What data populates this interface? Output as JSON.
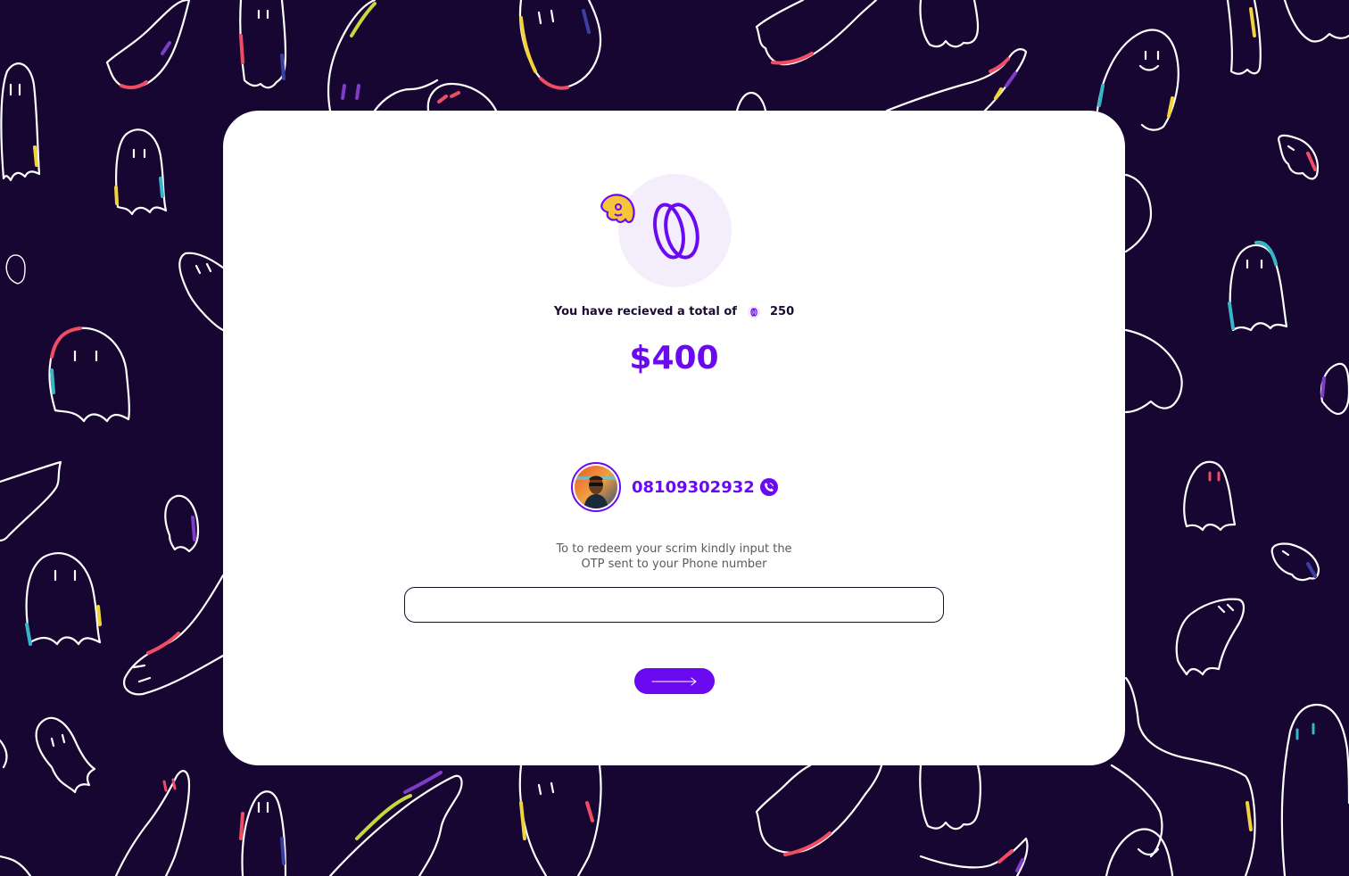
{
  "colors": {
    "background": "#170532",
    "card": "#ffffff",
    "accent": "#6b0af0",
    "coin_bg": "#f4eefc",
    "badge_yellow": "#f7c53a",
    "text_dark": "#1b0b33",
    "text_muted": "#5a5a5a"
  },
  "icons": {
    "coin": "scrim-coin-icon",
    "badge": "ghost-badge-icon",
    "phone": "phone-icon",
    "submit": "arrow-right-icon"
  },
  "reward": {
    "total_label": "You have recieved a total of",
    "coin_amount": "250",
    "dollar_amount": "$400"
  },
  "user": {
    "phone_number": "08109302932"
  },
  "otp": {
    "instruction_line1": "To to redeem your scrim kindly input the",
    "instruction_line2": "OTP sent to your Phone number",
    "value": "",
    "placeholder": ""
  }
}
